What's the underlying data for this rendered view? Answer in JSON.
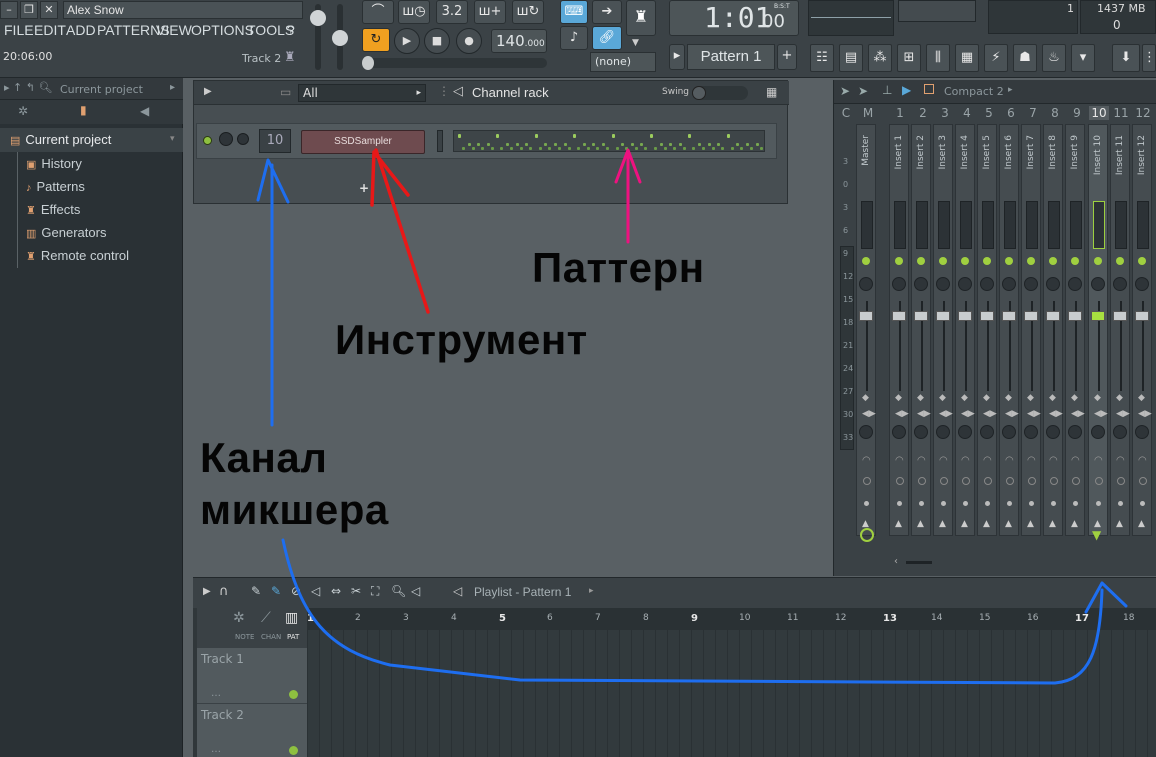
{
  "titlebar": {
    "user": "Alex Snow",
    "time": "20:06:00",
    "track_hint": "Track 2"
  },
  "menu": {
    "items": [
      "FILE",
      "EDIT",
      "ADD",
      "PATTERNS",
      "VIEW",
      "OPTIONS",
      "TOOLS",
      "?"
    ]
  },
  "transport": {
    "snap": "3.2",
    "tempo_int": "140",
    "tempo_dec": ".000",
    "song_time": "1:01",
    "song_time_ticks": "00",
    "bst_label": "B:S:T",
    "pattern_name": "Pattern 1",
    "none_label": "(none)",
    "cpu_value": "1",
    "memory": "1437 MB",
    "poly": "0"
  },
  "browser": {
    "header": "Current project",
    "root": "Current project",
    "items": [
      "History",
      "Patterns",
      "Effects",
      "Generators",
      "Remote control"
    ]
  },
  "channel_rack": {
    "filter": "All",
    "title": "Channel rack",
    "swing_label": "Swing",
    "channel_number": "10",
    "instrument": "SSDSampler",
    "add_label": "+"
  },
  "mixer": {
    "title": "Compact 2",
    "columns": [
      "C",
      "M",
      "1",
      "2",
      "3",
      "4",
      "5",
      "6",
      "7",
      "8",
      "9",
      "10",
      "11",
      "12"
    ],
    "strips": [
      "Master",
      "Insert 1",
      "Insert 2",
      "Insert 3",
      "Insert 4",
      "Insert 5",
      "Insert 6",
      "Insert 7",
      "Insert 8",
      "Insert 9",
      "Insert 10",
      "Insert 11",
      "Insert 12"
    ],
    "scale": [
      "3",
      "0",
      "3",
      "6",
      "9",
      "12",
      "15",
      "18",
      "21",
      "24",
      "27",
      "30",
      "33"
    ],
    "selected_index": 10
  },
  "playlist": {
    "title": "Playlist - Pattern 1",
    "mode_labels": [
      "NOTE",
      "CHAN",
      "PAT"
    ],
    "tracks": [
      "Track 1",
      "Track 2"
    ],
    "bars": [
      "1",
      "2",
      "3",
      "4",
      "5",
      "6",
      "7",
      "8",
      "9",
      "10",
      "11",
      "12",
      "13",
      "14",
      "15",
      "16",
      "17",
      "18"
    ]
  },
  "annotations": {
    "pattern": "Паттерн",
    "instrument": "Инструмент",
    "mixer_line1": "Канал",
    "mixer_line2": "микшера"
  },
  "colors": {
    "arrow_blue": "#1e6ef0",
    "arrow_red": "#e81818",
    "arrow_pink": "#ee1280",
    "accent_green": "#a0d040",
    "accent_orange": "#f0a020",
    "accent_blue": "#5aa8d8"
  }
}
